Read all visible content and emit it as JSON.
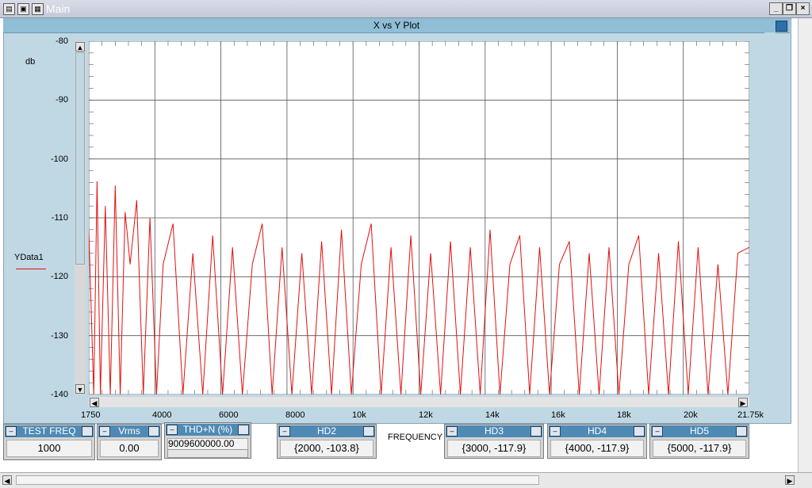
{
  "window": {
    "title": "Main"
  },
  "plot": {
    "title": "X vs Y Plot",
    "y_unit": "db",
    "legend": "YData1",
    "legend_color": "#e01010",
    "x_axis_label": "FREQUENCY"
  },
  "chart_data": {
    "type": "line",
    "title": "X vs Y Plot",
    "ylabel": "db",
    "xlabel": "FREQUENCY",
    "xlim": [
      1750,
      21750
    ],
    "ylim": [
      -140,
      -80
    ],
    "y_ticks": [
      "-80",
      "-90",
      "-100",
      "-110",
      "-120",
      "-130",
      "-140"
    ],
    "x_ticks": [
      "1750",
      "4000",
      "6000",
      "8000",
      "10k",
      "12k",
      "14k",
      "16k",
      "18k",
      "20k",
      "21.75k"
    ],
    "grid": true,
    "series": [
      {
        "name": "YData1",
        "color": "#e01010",
        "x": [
          1750,
          1900,
          2000,
          2100,
          2250,
          2400,
          2550,
          2700,
          2850,
          3000,
          3200,
          3400,
          3600,
          3800,
          4000,
          4300,
          4600,
          4900,
          5200,
          5500,
          5800,
          6100,
          6400,
          6700,
          7000,
          7300,
          7600,
          7900,
          8200,
          8500,
          8800,
          9100,
          9400,
          9700,
          10000,
          10300,
          10600,
          10900,
          11200,
          11500,
          11800,
          12100,
          12400,
          12700,
          13000,
          13300,
          13600,
          13900,
          14200,
          14500,
          14800,
          15100,
          15400,
          15700,
          16000,
          16300,
          16600,
          16900,
          17200,
          17500,
          17800,
          18100,
          18400,
          18700,
          19000,
          19300,
          19600,
          19900,
          20200,
          20500,
          20800,
          21100,
          21400,
          21750
        ],
        "y": [
          -112,
          -140,
          -103.8,
          -140,
          -108,
          -140,
          -104.5,
          -140,
          -109,
          -117.9,
          -107,
          -140,
          -110,
          -140,
          -117.9,
          -111,
          -140,
          -116,
          -140,
          -113,
          -140,
          -115,
          -140,
          -117.9,
          -111,
          -140,
          -115,
          -140,
          -116,
          -140,
          -114,
          -140,
          -112,
          -140,
          -117.9,
          -111,
          -140,
          -115,
          -140,
          -113,
          -140,
          -116,
          -140,
          -114,
          -140,
          -115,
          -140,
          -112,
          -140,
          -117.9,
          -113,
          -140,
          -115,
          -140,
          -117.9,
          -114,
          -140,
          -116,
          -140,
          -115,
          -140,
          -117.9,
          -113,
          -140,
          -116,
          -140,
          -114,
          -140,
          -115,
          -140,
          -117.9,
          -140,
          -116,
          -115
        ]
      }
    ]
  },
  "widgets": [
    {
      "name": "test-freq",
      "label": "TEST FREQ",
      "value": "1000"
    },
    {
      "name": "vrms",
      "label": "Vrms",
      "value": "0.00"
    },
    {
      "name": "thd-n",
      "label": "THD+N (%)",
      "value": "9009600000.00"
    },
    {
      "name": "hd2",
      "label": "HD2",
      "value": "{2000, -103.8}"
    },
    {
      "name": "hd3",
      "label": "HD3",
      "value": "{3000, -117.9}"
    },
    {
      "name": "hd4",
      "label": "HD4",
      "value": "{4000, -117.9}"
    },
    {
      "name": "hd5",
      "label": "HD5",
      "value": "{5000, -117.9}"
    }
  ],
  "controls": {
    "minimize": "_",
    "restore": "❐",
    "close": "×",
    "widget_minus": "–"
  }
}
